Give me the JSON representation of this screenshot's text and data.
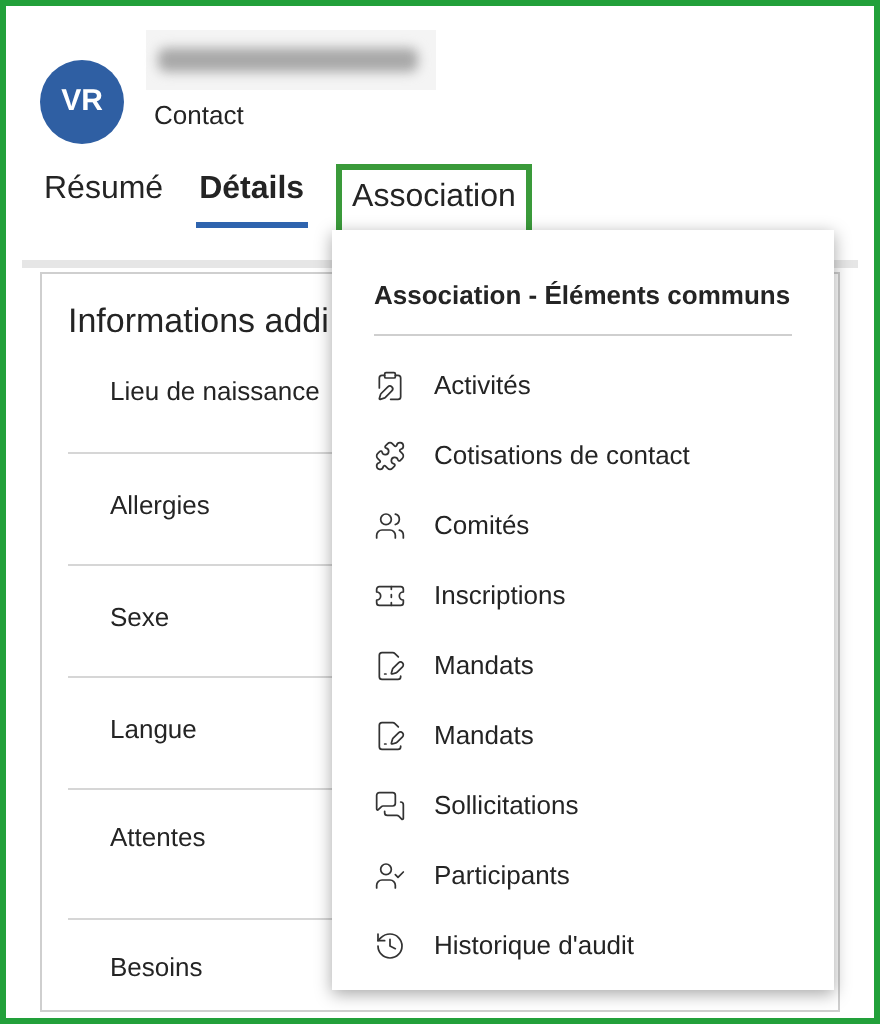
{
  "header": {
    "initials": "VR",
    "subtitle": "Contact"
  },
  "tabs": [
    {
      "label": "Résumé",
      "selected": false,
      "outlined": false
    },
    {
      "label": "Détails",
      "selected": true,
      "outlined": false
    },
    {
      "label": "Association",
      "selected": false,
      "outlined": true
    }
  ],
  "section": {
    "title": "Informations addi",
    "fields": [
      "Lieu de naissance",
      "Allergies",
      "Sexe",
      "Langue",
      "Attentes",
      "Besoins"
    ]
  },
  "menu": {
    "title": "Association - Éléments communs",
    "items": [
      "Activités",
      "Cotisations de contact",
      "Comités",
      "Inscriptions",
      "Mandats",
      "Mandats",
      "Sollicitations",
      "Participants",
      "Historique d'audit"
    ]
  }
}
